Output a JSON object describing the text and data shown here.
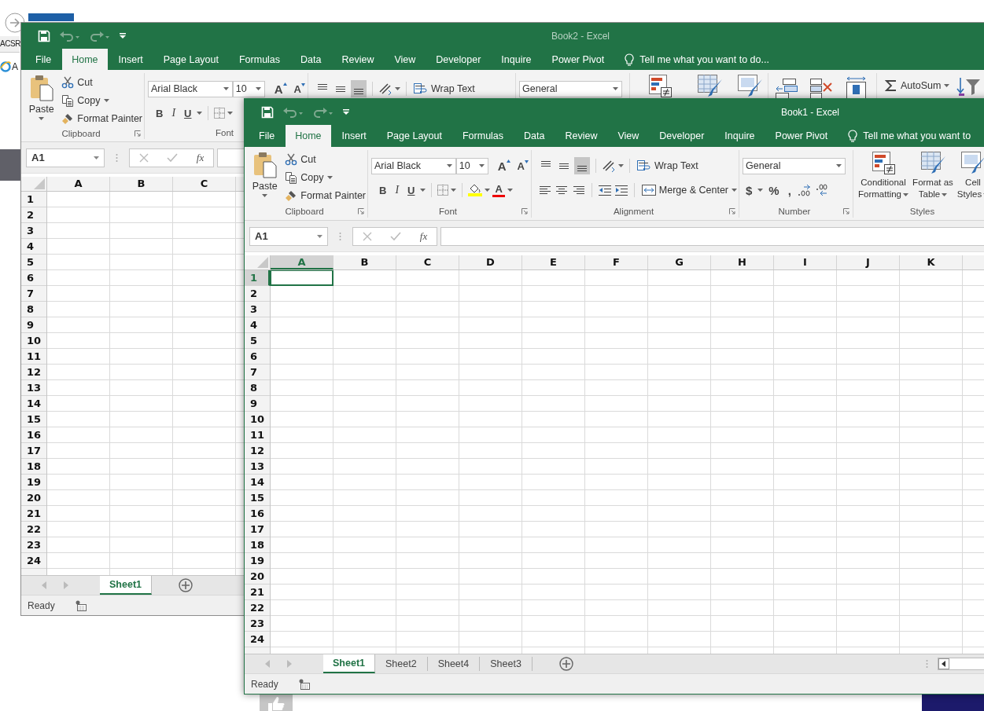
{
  "browser": {
    "menu_fragment": "ACSR",
    "link_fragment": "A"
  },
  "windows": [
    {
      "title": "Book2 - Excel",
      "active": false,
      "tabs": [
        {
          "label": "File",
          "selected": false
        },
        {
          "label": "Home",
          "selected": true
        },
        {
          "label": "Insert",
          "selected": false
        },
        {
          "label": "Page Layout",
          "selected": false
        },
        {
          "label": "Formulas",
          "selected": false
        },
        {
          "label": "Data",
          "selected": false
        },
        {
          "label": "Review",
          "selected": false
        },
        {
          "label": "View",
          "selected": false
        },
        {
          "label": "Developer",
          "selected": false
        },
        {
          "label": "Inquire",
          "selected": false
        },
        {
          "label": "Power Pivot",
          "selected": false
        }
      ],
      "tell_me": "Tell me what you want to do...",
      "clipboard": {
        "paste": "Paste",
        "cut": "Cut",
        "copy": "Copy",
        "format_painter": "Format Painter",
        "label": "Clipboard"
      },
      "font": {
        "name": "Arial Black",
        "size": "10",
        "grow": "A",
        "shrink": "A",
        "bold": "B",
        "italic": "I",
        "underline": "U",
        "label": "Font"
      },
      "alignment": {
        "vertical_align": [
          {
            "selected": false
          },
          {
            "selected": false
          },
          {
            "selected": true
          }
        ],
        "wrap_text": "Wrap Text"
      },
      "number": {
        "format": "General"
      },
      "editing": {
        "autosum": "AutoSum"
      },
      "name_box": "A1",
      "fx": "fx",
      "columns": [
        {
          "label": "A",
          "selected": false
        },
        {
          "label": "B",
          "selected": false
        },
        {
          "label": "C",
          "selected": false
        }
      ],
      "rows": [
        {
          "label": "1",
          "selected": false
        },
        {
          "label": "2",
          "selected": false
        },
        {
          "label": "3",
          "selected": false
        },
        {
          "label": "4",
          "selected": false
        },
        {
          "label": "5",
          "selected": false
        },
        {
          "label": "6",
          "selected": false
        },
        {
          "label": "7",
          "selected": false
        },
        {
          "label": "8",
          "selected": false
        },
        {
          "label": "9",
          "selected": false
        },
        {
          "label": "10",
          "selected": false
        },
        {
          "label": "11",
          "selected": false
        },
        {
          "label": "12",
          "selected": false
        },
        {
          "label": "13",
          "selected": false
        },
        {
          "label": "14",
          "selected": false
        },
        {
          "label": "15",
          "selected": false
        },
        {
          "label": "16",
          "selected": false
        },
        {
          "label": "17",
          "selected": false
        },
        {
          "label": "18",
          "selected": false
        },
        {
          "label": "19",
          "selected": false
        },
        {
          "label": "20",
          "selected": false
        },
        {
          "label": "21",
          "selected": false
        },
        {
          "label": "22",
          "selected": false
        },
        {
          "label": "23",
          "selected": false
        },
        {
          "label": "24",
          "selected": false
        }
      ],
      "sheets": [
        {
          "label": "Sheet1",
          "selected": true
        }
      ],
      "status": "Ready"
    },
    {
      "title": "Book1 - Excel",
      "active": true,
      "tabs": [
        {
          "label": "File",
          "selected": false
        },
        {
          "label": "Home",
          "selected": true
        },
        {
          "label": "Insert",
          "selected": false
        },
        {
          "label": "Page Layout",
          "selected": false
        },
        {
          "label": "Formulas",
          "selected": false
        },
        {
          "label": "Data",
          "selected": false
        },
        {
          "label": "Review",
          "selected": false
        },
        {
          "label": "View",
          "selected": false
        },
        {
          "label": "Developer",
          "selected": false
        },
        {
          "label": "Inquire",
          "selected": false
        },
        {
          "label": "Power Pivot",
          "selected": false
        }
      ],
      "tell_me": "Tell me what you want to",
      "clipboard": {
        "paste": "Paste",
        "cut": "Cut",
        "copy": "Copy",
        "format_painter": "Format Painter",
        "label": "Clipboard"
      },
      "font": {
        "name": "Arial Black",
        "size": "10",
        "grow": "A",
        "shrink": "A",
        "bold": "B",
        "italic": "I",
        "underline": "U",
        "font_color": "A",
        "label": "Font"
      },
      "alignment": {
        "vertical_align": [
          {
            "selected": false
          },
          {
            "selected": false
          },
          {
            "selected": true
          }
        ],
        "wrap_text": "Wrap Text",
        "merge": "Merge & Center",
        "label": "Alignment"
      },
      "number": {
        "format": "General",
        "currency": "$",
        "percent": "%",
        "comma": ",",
        "label": "Number"
      },
      "styles": {
        "buttons": [
          "Conditional Formatting",
          "Format as Table",
          "Cell Styles"
        ],
        "label": "Styles"
      },
      "name_box": "A1",
      "fx": "fx",
      "columns": [
        {
          "label": "A",
          "selected": true
        },
        {
          "label": "B",
          "selected": false
        },
        {
          "label": "C",
          "selected": false
        },
        {
          "label": "D",
          "selected": false
        },
        {
          "label": "E",
          "selected": false
        },
        {
          "label": "F",
          "selected": false
        },
        {
          "label": "G",
          "selected": false
        },
        {
          "label": "H",
          "selected": false
        },
        {
          "label": "I",
          "selected": false
        },
        {
          "label": "J",
          "selected": false
        },
        {
          "label": "K",
          "selected": false
        }
      ],
      "rows": [
        {
          "label": "1",
          "selected": true
        },
        {
          "label": "2",
          "selected": false
        },
        {
          "label": "3",
          "selected": false
        },
        {
          "label": "4",
          "selected": false
        },
        {
          "label": "5",
          "selected": false
        },
        {
          "label": "6",
          "selected": false
        },
        {
          "label": "7",
          "selected": false
        },
        {
          "label": "8",
          "selected": false
        },
        {
          "label": "9",
          "selected": false
        },
        {
          "label": "10",
          "selected": false
        },
        {
          "label": "11",
          "selected": false
        },
        {
          "label": "12",
          "selected": false
        },
        {
          "label": "13",
          "selected": false
        },
        {
          "label": "14",
          "selected": false
        },
        {
          "label": "15",
          "selected": false
        },
        {
          "label": "16",
          "selected": false
        },
        {
          "label": "17",
          "selected": false
        },
        {
          "label": "18",
          "selected": false
        },
        {
          "label": "19",
          "selected": false
        },
        {
          "label": "20",
          "selected": false
        },
        {
          "label": "21",
          "selected": false
        },
        {
          "label": "22",
          "selected": false
        },
        {
          "label": "23",
          "selected": false
        },
        {
          "label": "24",
          "selected": false
        }
      ],
      "sheets": [
        {
          "label": "Sheet1",
          "selected": true
        },
        {
          "label": "Sheet2",
          "selected": false
        },
        {
          "label": "Sheet4",
          "selected": false
        },
        {
          "label": "Sheet3",
          "selected": false
        }
      ],
      "status": "Ready"
    }
  ]
}
